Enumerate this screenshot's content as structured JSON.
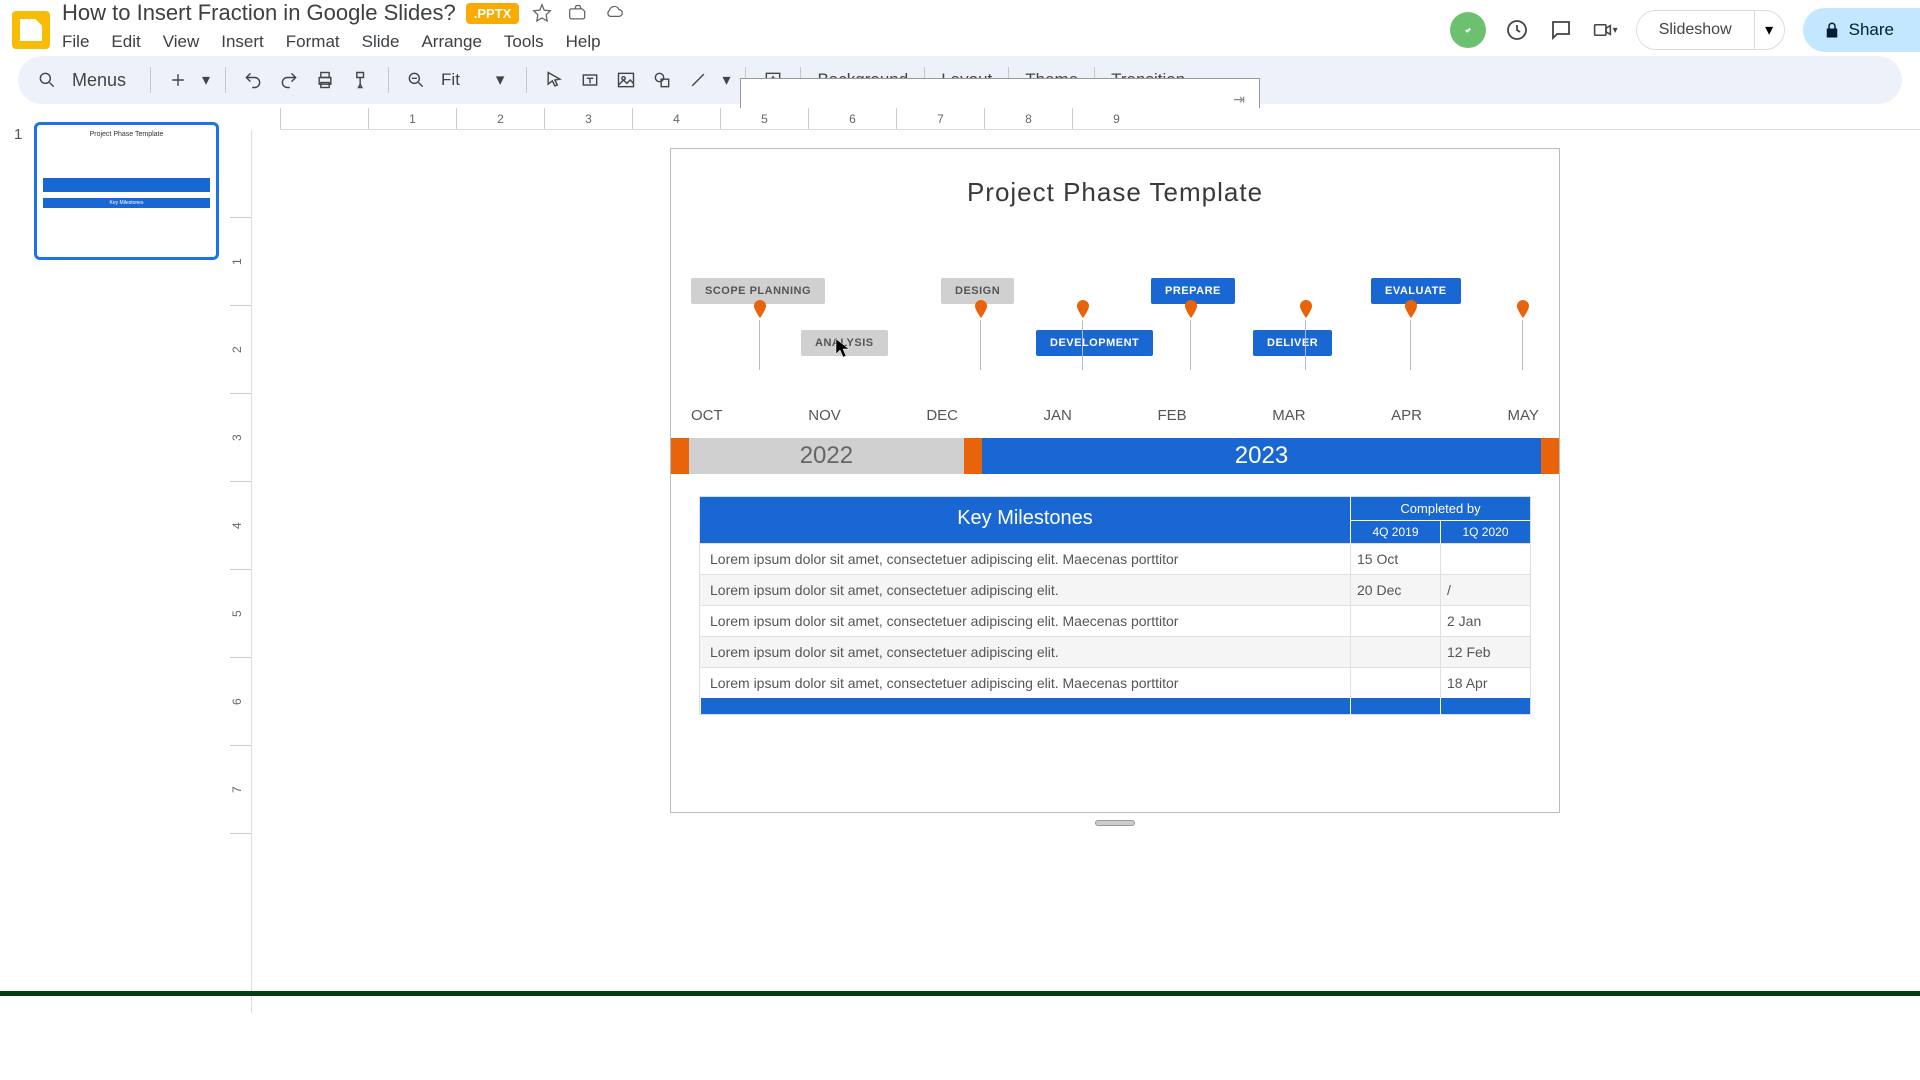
{
  "doc": {
    "title": "How to Insert Fraction in Google Slides?",
    "badge": ".PPTX"
  },
  "menu": {
    "file": "File",
    "edit": "Edit",
    "view": "View",
    "insert": "Insert",
    "format": "Format",
    "slide": "Slide",
    "arrange": "Arrange",
    "tools": "Tools",
    "help": "Help"
  },
  "toolbar": {
    "menus": "Menus",
    "zoom": "Fit",
    "background": "Background",
    "layout": "Layout",
    "theme": "Theme",
    "transition": "Transition"
  },
  "actions": {
    "slideshow": "Slideshow",
    "share": "Share"
  },
  "sidebar": {
    "num": "1"
  },
  "slide": {
    "title": "Project Phase Template",
    "phases": {
      "scope": "SCOPE PLANNING",
      "analysis": "ANALYSIS",
      "design": "DESIGN",
      "development": "DEVELOPMENT",
      "prepare": "PREPARE",
      "deliver": "DELIVER",
      "evaluate": "EVALUATE"
    },
    "months": {
      "oct": "OCT",
      "nov": "NOV",
      "dec": "DEC",
      "jan": "JAN",
      "feb": "FEB",
      "mar": "MAR",
      "apr": "APR",
      "may": "MAY"
    },
    "years": {
      "y22": "2022",
      "y23": "2023"
    },
    "table": {
      "header": "Key Milestones",
      "completed": "Completed by",
      "col1": "4Q 2019",
      "col2": "1Q 2020",
      "rows": [
        {
          "desc": "Lorem ipsum dolor sit amet, consectetuer adipiscing elit. Maecenas porttitor",
          "c1": "15 Oct",
          "c2": ""
        },
        {
          "desc": "Lorem ipsum dolor sit amet, consectetuer adipiscing elit.",
          "c1": "20 Dec",
          "c2": "/"
        },
        {
          "desc": "Lorem ipsum dolor sit amet, consectetuer adipiscing elit. Maecenas porttitor",
          "c1": "",
          "c2": "2 Jan"
        },
        {
          "desc": "Lorem ipsum dolor sit amet, consectetuer adipiscing elit.",
          "c1": "",
          "c2": "12 Feb"
        },
        {
          "desc": "Lorem ipsum dolor sit amet, consectetuer adipiscing elit. Maecenas porttitor",
          "c1": "",
          "c2": "18 Apr"
        }
      ]
    }
  },
  "ruler": {
    "h": [
      "",
      "1",
      "2",
      "3",
      "4",
      "5",
      "6",
      "7",
      "8",
      "9"
    ],
    "v": [
      "",
      "1",
      "2",
      "3",
      "4",
      "5",
      "6",
      "7"
    ]
  }
}
